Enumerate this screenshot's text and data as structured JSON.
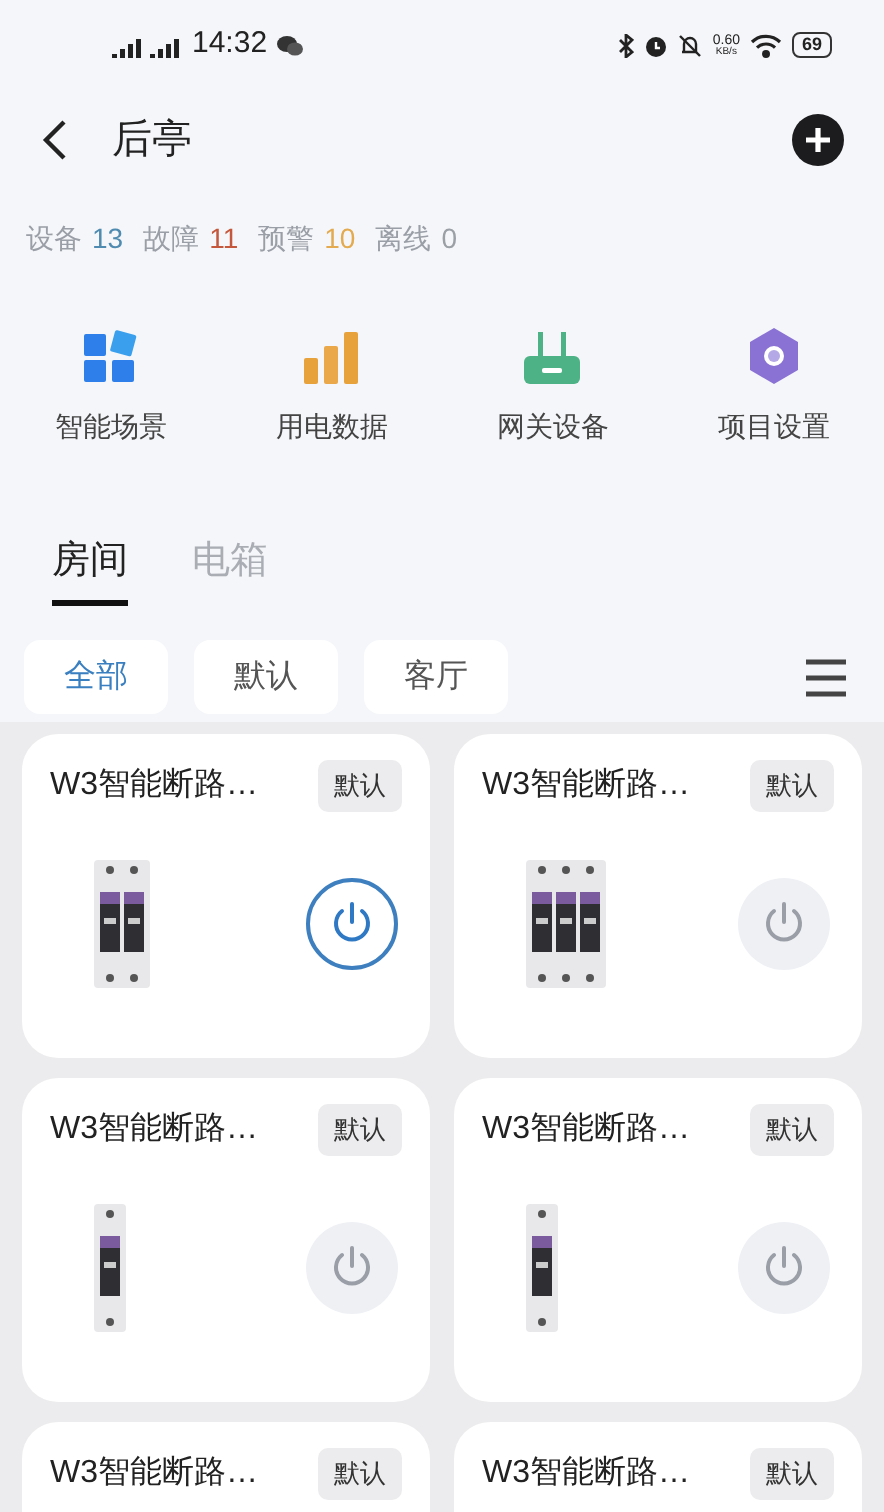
{
  "status_bar": {
    "time": "14:32",
    "speed": "0.60",
    "speed_unit": "KB/s",
    "battery": "69"
  },
  "header": {
    "title": "后亭"
  },
  "stats": [
    {
      "label": "设备",
      "value": "13",
      "color": "#4f8bb0"
    },
    {
      "label": "故障",
      "value": "11",
      "color": "#c4573c"
    },
    {
      "label": "预警",
      "value": "10",
      "color": "#e3aa4f"
    },
    {
      "label": "离线",
      "value": "0",
      "color": "#9aa0a6"
    }
  ],
  "shortcuts": [
    {
      "kind": "scenes",
      "label": "智能场景"
    },
    {
      "kind": "power",
      "label": "用电数据"
    },
    {
      "kind": "gateway",
      "label": "网关设备"
    },
    {
      "kind": "settings",
      "label": "项目设置"
    }
  ],
  "tabs": [
    {
      "label": "房间",
      "selected": true
    },
    {
      "label": "电箱",
      "selected": false
    }
  ],
  "filters": [
    {
      "label": "全部",
      "selected": true
    },
    {
      "label": "默认",
      "selected": false
    },
    {
      "label": "客厅",
      "selected": false
    }
  ],
  "devices": [
    {
      "name": "W3智能断路…",
      "tag": "默认",
      "on": true
    },
    {
      "name": "W3智能断路…",
      "tag": "默认",
      "on": false
    },
    {
      "name": "W3智能断路…",
      "tag": "默认",
      "on": false
    },
    {
      "name": "W3智能断路…",
      "tag": "默认",
      "on": false
    },
    {
      "name": "W3智能断路…",
      "tag": "默认"
    },
    {
      "name": "W3智能断路…",
      "tag": "默认"
    }
  ]
}
